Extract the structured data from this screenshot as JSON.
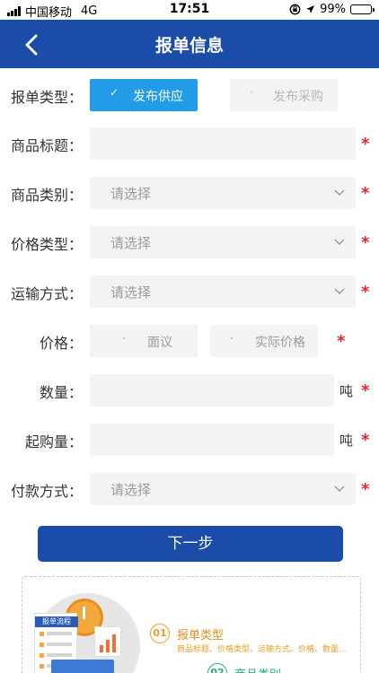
{
  "status_bar": {
    "carrier": "中国移动",
    "network": "4G",
    "time": "17:51",
    "battery": "99%"
  },
  "nav": {
    "title": "报单信息"
  },
  "form": {
    "report_type": {
      "label": "报单类型：",
      "options": [
        {
          "label": "发布供应",
          "mark": "✓",
          "selected": true
        },
        {
          "label": "发布采购",
          "mark": "·",
          "selected": false
        }
      ]
    },
    "product_title": {
      "label": "商品标题：",
      "value": "",
      "required_mark": "*"
    },
    "product_category": {
      "label": "商品类别：",
      "value": "请选择",
      "required_mark": "*"
    },
    "price_type": {
      "label": "价格类型：",
      "value": "请选择",
      "required_mark": "*"
    },
    "transport": {
      "label": "运输方式：",
      "value": "请选择",
      "required_mark": "*"
    },
    "price": {
      "label": "价格：",
      "options": [
        {
          "label": "面议",
          "mark": "·"
        },
        {
          "label": "实际价格",
          "mark": "·"
        }
      ],
      "required_mark": "*"
    },
    "quantity": {
      "label": "数量：",
      "value": "",
      "unit": "吨",
      "required_mark": "*"
    },
    "min_purchase": {
      "label": "起购量：",
      "value": "",
      "unit": "吨",
      "required_mark": "*"
    },
    "payment": {
      "label": "付款方式：",
      "value": "请选择",
      "required_mark": "*"
    }
  },
  "next_button": {
    "label": "下一步"
  },
  "guide": {
    "board_title": "报单流程",
    "step1": {
      "num": "01",
      "title": "报单类型",
      "desc": "商品标题、价格类型、运输方式、价格、数量..."
    },
    "step2": {
      "num": "02",
      "title": "商品类别"
    }
  },
  "colors": {
    "primary": "#1b4ca8",
    "selected": "#239ce8",
    "required": "#e5262d",
    "field_bg": "#f3f3f3"
  }
}
